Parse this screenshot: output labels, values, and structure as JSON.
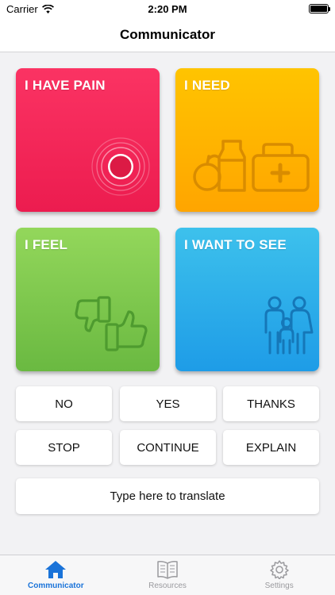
{
  "status_bar": {
    "carrier": "Carrier",
    "time": "2:20 PM"
  },
  "nav": {
    "title": "Communicator"
  },
  "tiles": [
    {
      "label": "I HAVE PAIN",
      "icon": "pain-target-icon",
      "color": "#f4285a"
    },
    {
      "label": "I NEED",
      "icon": "food-medkit-icon",
      "color": "#ffb300"
    },
    {
      "label": "I FEEL",
      "icon": "thumbs-icon",
      "color": "#7cc84c"
    },
    {
      "label": "I WANT TO SEE",
      "icon": "family-icon",
      "color": "#2aabe9"
    }
  ],
  "phrases": [
    "NO",
    "YES",
    "THANKS",
    "STOP",
    "CONTINUE",
    "EXPLAIN"
  ],
  "translate": {
    "placeholder": "Type here to translate"
  },
  "tabs": [
    {
      "label": "Communicator",
      "icon": "home-icon",
      "active": true
    },
    {
      "label": "Resources",
      "icon": "book-icon",
      "active": false
    },
    {
      "label": "Settings",
      "icon": "gear-icon",
      "active": false
    }
  ],
  "colors": {
    "accent": "#1a73d9"
  }
}
